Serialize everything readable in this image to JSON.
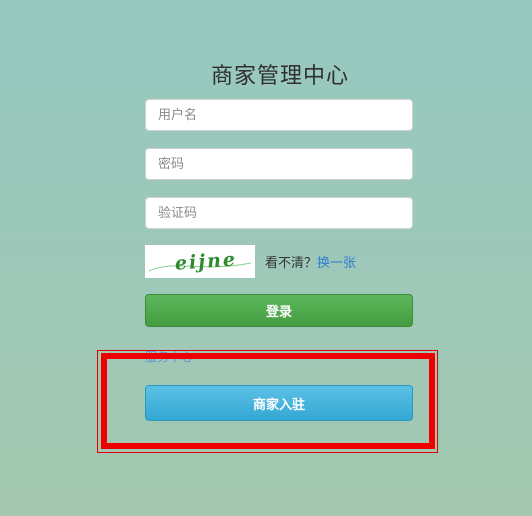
{
  "page": {
    "title": "商家管理中心"
  },
  "form": {
    "username_placeholder": "用户名",
    "password_placeholder": "密码",
    "captcha_placeholder": "验证码",
    "captcha_image_text": "eijne",
    "captcha_hint": "看不清？",
    "captcha_refresh_label": "换一张",
    "login_label": "登录",
    "service_center_label": "服务中心",
    "register_label": "商家入驻"
  },
  "colors": {
    "login_button": "#4cae4c",
    "register_button": "#3ab0d9",
    "highlight_border": "#ec0000",
    "captcha_text": "#2e8b2e"
  }
}
